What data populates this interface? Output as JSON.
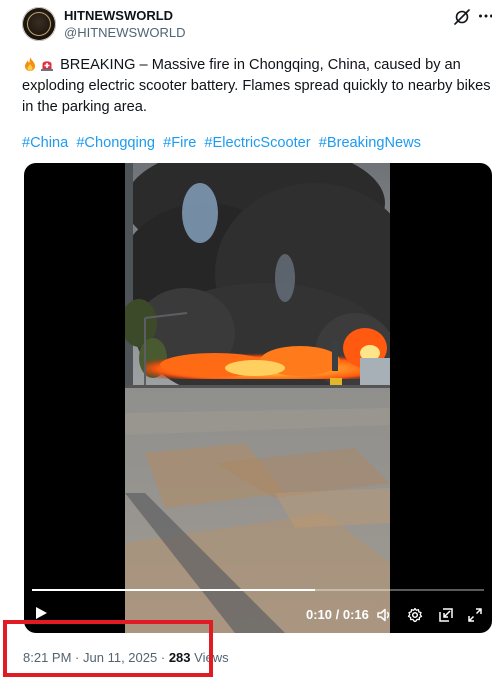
{
  "author": {
    "display_name": "HITNEWSWORLD",
    "handle": "@HITNEWSWORLD"
  },
  "tweet": {
    "text": "BREAKING – Massive fire in Chongqing, China, caused by an exploding electric scooter battery. Flames spread quickly to nearby bikes in the parking area.",
    "emojis": [
      "fire-emoji",
      "siren-emoji"
    ],
    "hashtags": [
      "#China",
      "#Chongqing",
      "#Fire",
      "#ElectricScooter",
      "#BreakingNews"
    ]
  },
  "video": {
    "time_display": "0:10 / 0:16",
    "progress_fraction": 0.625
  },
  "meta": {
    "time": "8:21 PM",
    "sep1": "·",
    "date": "Jun 11, 2025",
    "sep2": "·",
    "views_count": "283",
    "views_label": "Views"
  },
  "colors": {
    "link": "#1d9bf0",
    "secondary_text": "#536471",
    "highlight": "#e01b24"
  }
}
